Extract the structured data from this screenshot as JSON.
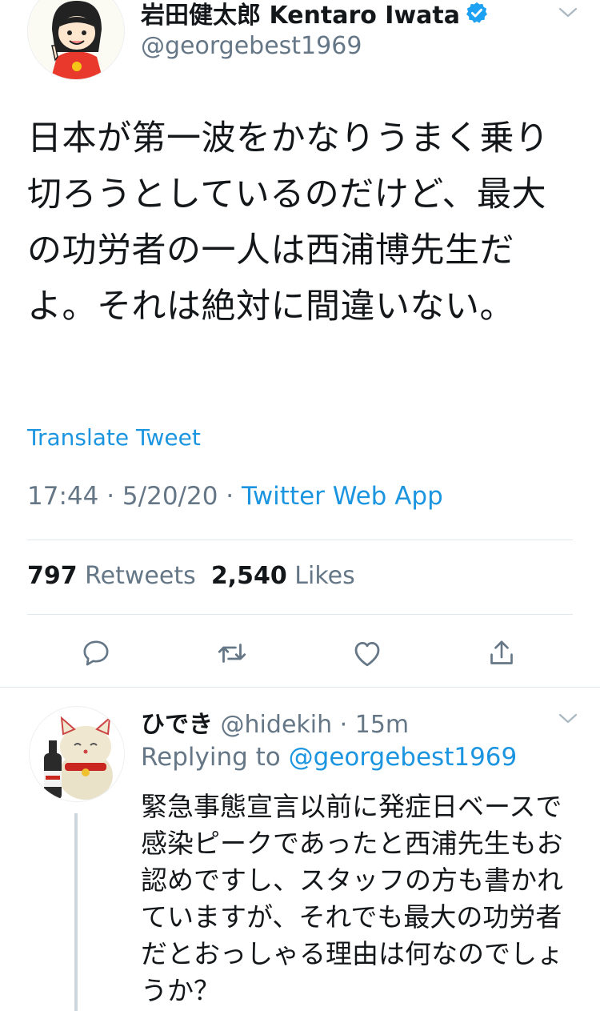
{
  "main_tweet": {
    "display_name": "岩田健太郎 Kentaro Iwata",
    "handle": "@georgebest1969",
    "text": "日本が第一波をかなりうまく乗り切ろうとしているのだけど、最大の功労者の一人は西浦博先生だよ。それは絶対に間違いない。",
    "translate_label": "Translate Tweet",
    "time": "17:44",
    "date": "5/20/20",
    "source": "Twitter Web App",
    "retweets_count": "797",
    "retweets_label": "Retweets",
    "likes_count": "2,540",
    "likes_label": "Likes",
    "icons": [
      "avatar",
      "verified-badge-icon",
      "chevron-down-icon",
      "reply-icon",
      "retweet-icon",
      "like-icon",
      "share-icon"
    ]
  },
  "reply_tweet": {
    "display_name": "ひでき",
    "handle": "@hidekih",
    "time": "15m",
    "replying_prefix": "Replying to",
    "replying_to": "@georgebest1969",
    "text": "緊急事態宣言以前に発症日ベースで感染ピークであったと西浦先生もお認めですし、スタッフの方も書かれていますが、それでも最大の功労者だとおっしゃる理由は何なのでしょうか？"
  },
  "colors": {
    "text": "#14171a",
    "secondary": "#657786",
    "accent": "#1b95e0",
    "divider": "#e1e8ed"
  }
}
